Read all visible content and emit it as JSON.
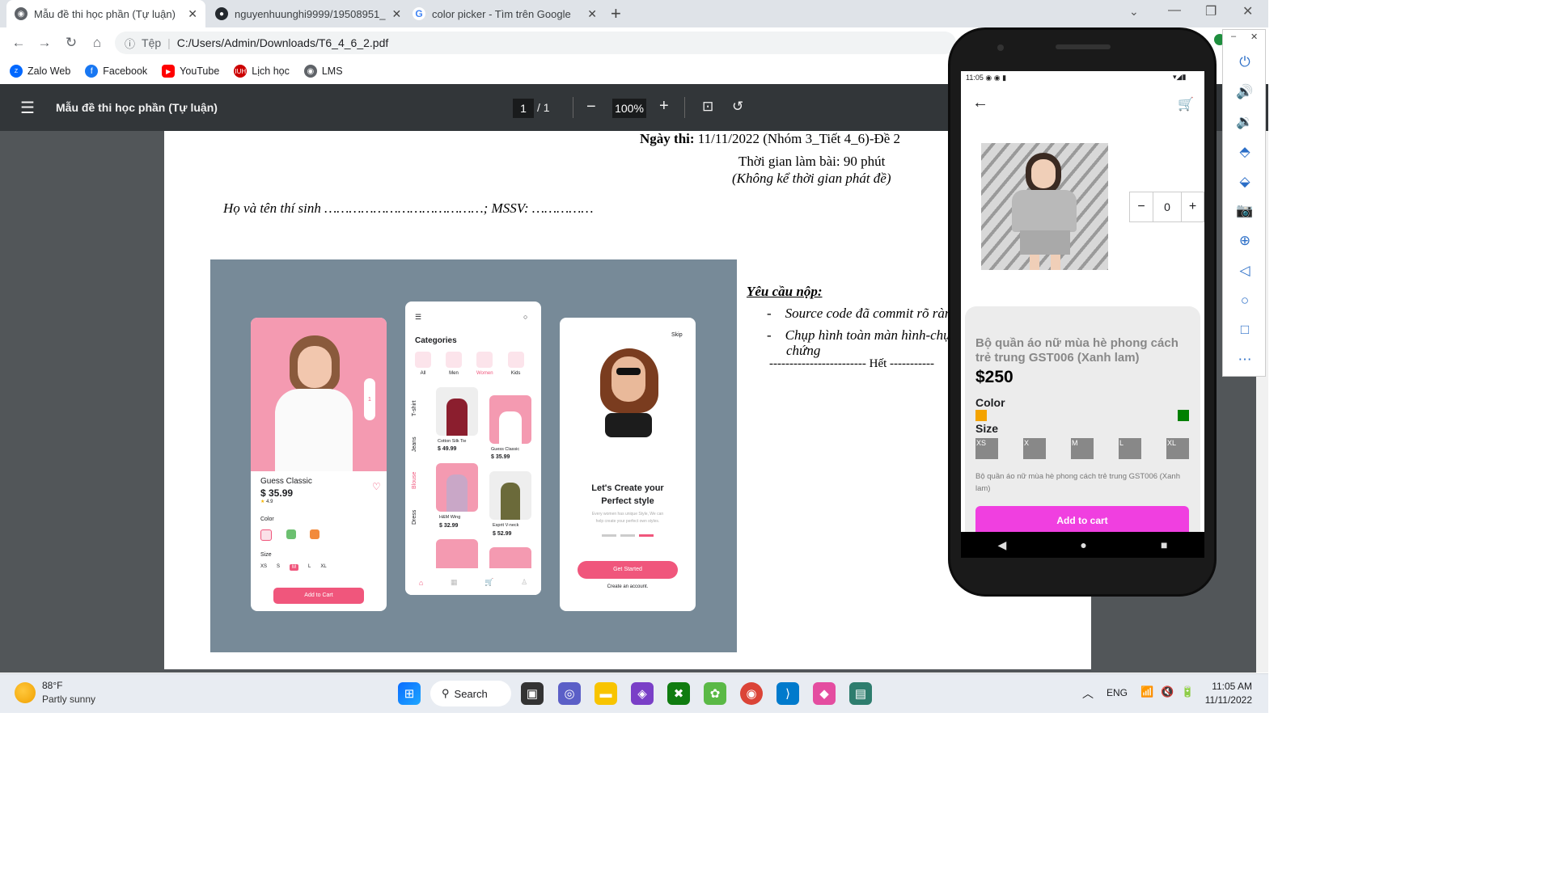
{
  "tabs": [
    {
      "title": "Mẫu đề thi học phần (Tự luận)",
      "icon": "globe-icon"
    },
    {
      "title": "nguyenhuunghi9999/19508951_",
      "icon": "github-icon"
    },
    {
      "title": "color picker - Tìm trên Google",
      "icon": "google-icon"
    }
  ],
  "address": {
    "scheme": "Tệp",
    "url": "C:/Users/Admin/Downloads/T6_4_6_2.pdf"
  },
  "bookmarks": [
    "Zalo Web",
    "Facebook",
    "YouTube",
    "Lịch học",
    "LMS"
  ],
  "pdf": {
    "title": "Mẫu đề thi học phần (Tự luận)",
    "page": "1",
    "total": "/  1",
    "zoom": "100%"
  },
  "doc": {
    "date_label": "Ngày thi:",
    "date_value": " 11/11/2022 (Nhóm 3_Tiết 4_6)-Đề 2",
    "time": "Thời gian làm bài: 90 phút",
    "time_note": "(Không kể thời gian phát đề)",
    "student": "Họ và tên thí sinh …………………………………; MSSV: ……………",
    "req_title": "Yêu cầu nộp:",
    "req1": "Source code đã commit rõ ràng",
    "req2": "Chụp hình toàn màn hình-chụ",
    "req2b": "chứng",
    "end": "------------------------ Hết -----------"
  },
  "mock": {
    "c1": {
      "name": "Guess Classic",
      "price": "$ 35.99",
      "rating": "4.9",
      "color": "Color",
      "size": "Size",
      "sizes": [
        "XS",
        "S",
        "M",
        "L",
        "XL"
      ],
      "btn": "Add to Cart",
      "qty": "1"
    },
    "c2": {
      "title": "Categories",
      "cats": [
        "All",
        "Men",
        "Women",
        "Kids"
      ],
      "side": [
        "T-shirt",
        "Jeans",
        "Blouse",
        "Dress"
      ],
      "items": [
        {
          "n": "Cotton Silk Tie",
          "p": "$ 49.99"
        },
        {
          "n": "Guess Classic",
          "p": "$ 35.99"
        },
        {
          "n": "H&M Wing",
          "p": "$ 32.99"
        },
        {
          "n": "Esprit V-neck",
          "p": "$ 52.99"
        }
      ]
    },
    "c3": {
      "skip": "Skip",
      "h1": "Let's Create your",
      "h2": "Perfect style",
      "sub1": "Every women has unique Style, We can",
      "sub2": "help create your perfect own styles.",
      "btn": "Get Started",
      "link": "Create an account."
    }
  },
  "app": {
    "time": "11:05",
    "qty": "0",
    "title": "Bộ quần áo nữ mùa hè phong cách trẻ trung GST006 (Xanh lam)",
    "price": "$250",
    "color_label": "Color",
    "size_label": "Size",
    "sizes": [
      "XS",
      "X",
      "M",
      "L",
      "XL"
    ],
    "desc": "Bộ quần áo nữ mùa hè phong cách trẻ trung GST006 (Xanh lam)",
    "btn": "Add to cart",
    "swatches": [
      "#f4a300",
      "#008000"
    ]
  },
  "weather": {
    "temp": "88°F",
    "cond": "Partly sunny"
  },
  "taskbar": {
    "search": "Search",
    "lang": "ENG",
    "time": "11:05 AM",
    "date": "11/11/2022"
  }
}
